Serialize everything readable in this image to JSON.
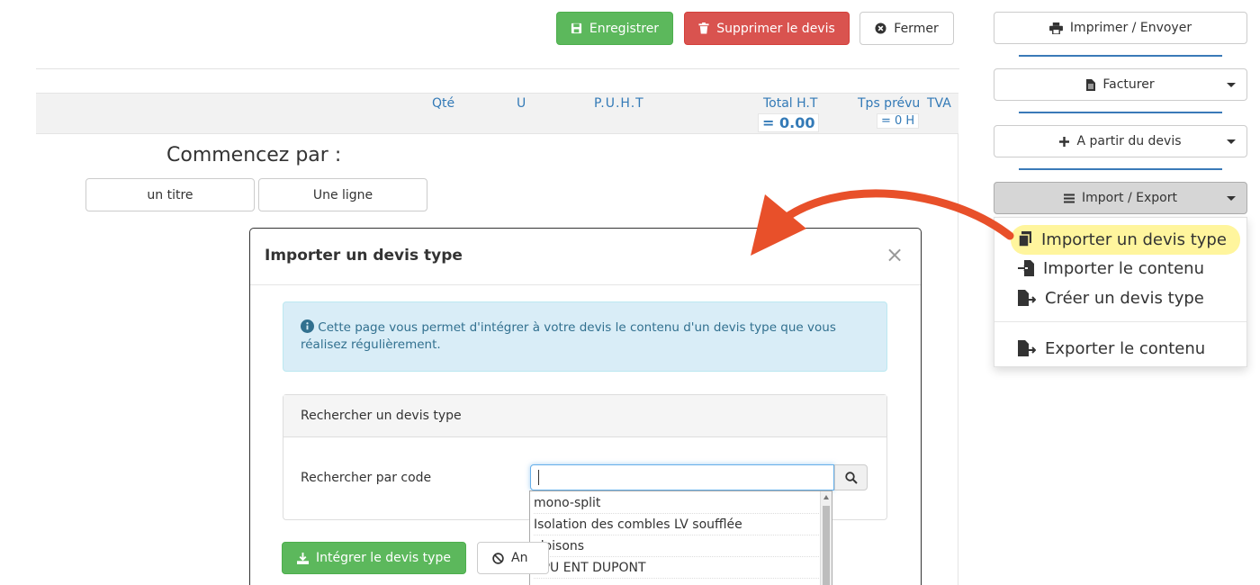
{
  "toolbar": {
    "save_label": "Enregistrer",
    "delete_label": "Supprimer le devis",
    "close_label": "Fermer"
  },
  "table_header": {
    "qty": "Qté",
    "unit": "U",
    "unit_price": "P.U.H.T",
    "total_ht": "Total H.T",
    "total_value": "= 0.00",
    "time_planned": "Tps prévu",
    "time_value": "= 0 H",
    "vat": "TVA"
  },
  "start": {
    "title": "Commencez par :",
    "title_button": "un titre",
    "line_button": "Une ligne"
  },
  "sidebar": {
    "print_label": "Imprimer / Envoyer",
    "invoice_label": "Facturer",
    "from_quote_label": "A partir du devis",
    "import_export_label": "Import / Export"
  },
  "dropdown": {
    "items": [
      {
        "label": "Importer un devis type"
      },
      {
        "label": "Importer le contenu"
      },
      {
        "label": "Créer un devis type"
      },
      {
        "label": "Exporter le contenu"
      }
    ]
  },
  "modal": {
    "title": "Importer un devis type",
    "close_symbol": "×",
    "info_text": "Cette page vous permet d'intégrer à votre devis le contenu d'un devis type que vous réalisez régulièrement.",
    "panel_title": "Rechercher un devis type",
    "search_label": "Rechercher par code",
    "search_value": "",
    "suggestions": [
      "mono-split",
      "Isolation des combles LV soufflée",
      "cloisons",
      "BPU ENT DUPONT"
    ],
    "integrate_label": "Intégrer le devis type",
    "cancel_label": "An"
  },
  "colors": {
    "success": "#5cb85c",
    "danger": "#d9534f",
    "link_blue": "#337ab7",
    "highlight": "#fff59d",
    "arrow": "#e8502a"
  }
}
